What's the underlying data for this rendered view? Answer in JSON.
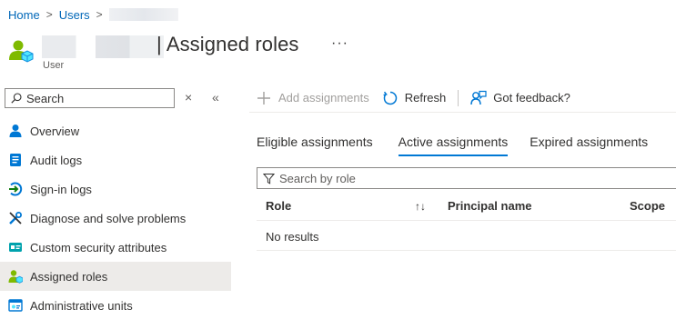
{
  "breadcrumb": {
    "items": [
      "Home",
      "Users"
    ]
  },
  "header": {
    "title": "| Assigned roles",
    "subtitle": "User",
    "more": "···"
  },
  "sidebar": {
    "search_placeholder": "Search",
    "close_label": "×",
    "collapse_label": "«",
    "items": [
      {
        "label": "Overview",
        "icon": "person-icon",
        "active": false
      },
      {
        "label": "Audit logs",
        "icon": "audit-log-icon",
        "active": false
      },
      {
        "label": "Sign-in logs",
        "icon": "sign-in-icon",
        "active": false
      },
      {
        "label": "Diagnose and solve problems",
        "icon": "wrench-icon",
        "active": false
      },
      {
        "label": "Custom security attributes",
        "icon": "attributes-icon",
        "active": false
      },
      {
        "label": "Assigned roles",
        "icon": "user-role-icon",
        "active": true
      },
      {
        "label": "Administrative units",
        "icon": "admin-units-icon",
        "active": false
      }
    ]
  },
  "toolbar": {
    "add_label": "Add assignments",
    "refresh_label": "Refresh",
    "feedback_label": "Got feedback?"
  },
  "tabs": [
    {
      "label": "Eligible assignments",
      "active": false
    },
    {
      "label": "Active assignments",
      "active": true
    },
    {
      "label": "Expired assignments",
      "active": false
    }
  ],
  "filter": {
    "placeholder": "Search by role"
  },
  "grid": {
    "columns": [
      "Role",
      "Principal name",
      "Scope"
    ],
    "sort_glyph": "↑↓",
    "empty_text": "No results"
  },
  "colors": {
    "link": "#0067b8",
    "accent": "#0078d4",
    "active_bg": "#edebe9"
  }
}
